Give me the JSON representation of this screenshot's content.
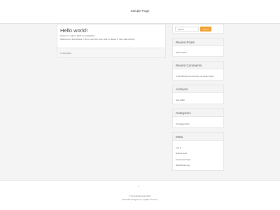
{
  "site": {
    "title": "Sample Page"
  },
  "post": {
    "title": "Hello world!",
    "meta_prefix": "Posted on",
    "date": "July 5, 2021",
    "meta_by": "by",
    "author": "bugwell13",
    "excerpt": "Welcome to WordPress. This is your first post. Edit or delete it, then start writing!",
    "comments_link": "1 Comment"
  },
  "search": {
    "placeholder": "Search ...",
    "button_label": "Search"
  },
  "widgets": {
    "recent_posts": {
      "title": "Recent Posts",
      "items": [
        "Hello world!"
      ]
    },
    "recent_comments": {
      "title": "Recent Comments",
      "author": "A WordPress Commenter",
      "on": "on",
      "post": "Hello world!"
    },
    "archives": {
      "title": "Archives",
      "items": [
        "July 2021"
      ]
    },
    "categories": {
      "title": "Categories",
      "items": [
        "Uncategorized"
      ]
    },
    "meta": {
      "title": "Meta",
      "items": [
        "Log in",
        "Entries feed",
        "Comments feed",
        "WordPress.org"
      ]
    }
  },
  "footer": {
    "scroll_top": "^",
    "copyright": "© DomainDomain 2021",
    "credits": "Best WP designed by Ingalls Themes."
  },
  "colors": {
    "accent": "#f0a030",
    "background": "#f4f4f4",
    "panel": "#ffffff"
  }
}
